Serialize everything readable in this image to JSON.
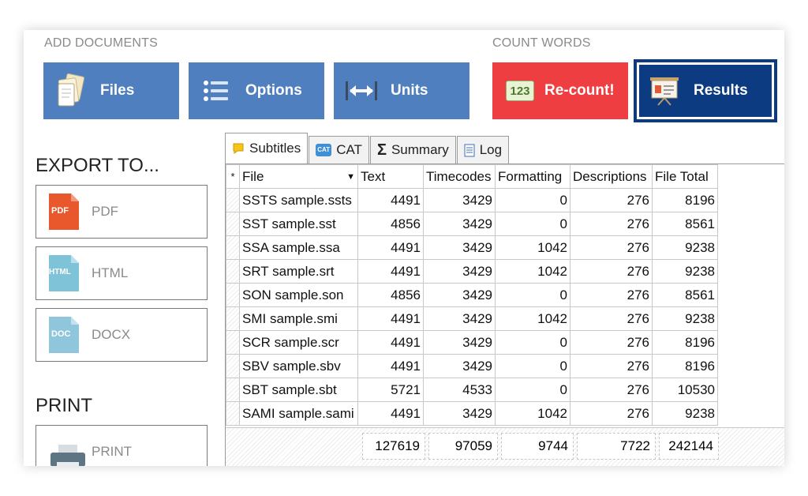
{
  "sections": {
    "add": "ADD DOCUMENTS",
    "count": "COUNT WORDS"
  },
  "buttons": {
    "files": "Files",
    "options": "Options",
    "units": "Units",
    "recount": "Re-count!",
    "results": "Results"
  },
  "icons": {
    "files": "documents-icon",
    "options": "list-icon",
    "units": "resize-arrows-icon",
    "recount": "123-icon",
    "results": "presentation-board-icon"
  },
  "counter_badge": "123",
  "export": {
    "title": "EXPORT TO...",
    "pdf": {
      "badge": "PDF",
      "label": "PDF"
    },
    "html": {
      "badge": "HTML",
      "label": "HTML"
    },
    "docx": {
      "badge": "DOC",
      "label": "DOCX"
    }
  },
  "print": {
    "title": "PRINT",
    "label": "PRINT"
  },
  "tabs": [
    {
      "label": "Subtitles",
      "icon": "speech-bubble-icon",
      "active": true
    },
    {
      "label": "CAT",
      "icon": "cat-icon",
      "badge": "CAT"
    },
    {
      "label": "Summary",
      "icon": "sigma-icon",
      "glyph": "Σ"
    },
    {
      "label": "Log",
      "icon": "log-icon"
    }
  ],
  "grid": {
    "marker": "*",
    "columns": [
      "File",
      "Text",
      "Timecodes",
      "Formatting",
      "Descriptions",
      "File Total"
    ],
    "rows": [
      [
        "SSTS sample.ssts",
        "4491",
        "3429",
        "0",
        "276",
        "8196"
      ],
      [
        "SST sample.sst",
        "4856",
        "3429",
        "0",
        "276",
        "8561"
      ],
      [
        "SSA sample.ssa",
        "4491",
        "3429",
        "1042",
        "276",
        "9238"
      ],
      [
        "SRT sample.srt",
        "4491",
        "3429",
        "1042",
        "276",
        "9238"
      ],
      [
        "SON sample.son",
        "4856",
        "3429",
        "0",
        "276",
        "8561"
      ],
      [
        "SMI sample.smi",
        "4491",
        "3429",
        "1042",
        "276",
        "9238"
      ],
      [
        "SCR sample.scr",
        "4491",
        "3429",
        "0",
        "276",
        "8196"
      ],
      [
        "SBV sample.sbv",
        "4491",
        "3429",
        "0",
        "276",
        "8196"
      ],
      [
        "SBT sample.sbt",
        "5721",
        "4533",
        "0",
        "276",
        "10530"
      ],
      [
        "SAMI sample.sami",
        "4491",
        "3429",
        "1042",
        "276",
        "9238"
      ]
    ],
    "totals": [
      "127619",
      "97059",
      "9744",
      "7722",
      "242144"
    ]
  },
  "colors": {
    "blue_button": "#4f7fbf",
    "red_button": "#ef3e42",
    "navy_button": "#0d3b82",
    "pdf_icon": "#e8582c",
    "html_icon": "#7ec3d8",
    "doc_icon": "#8fc6dc"
  }
}
